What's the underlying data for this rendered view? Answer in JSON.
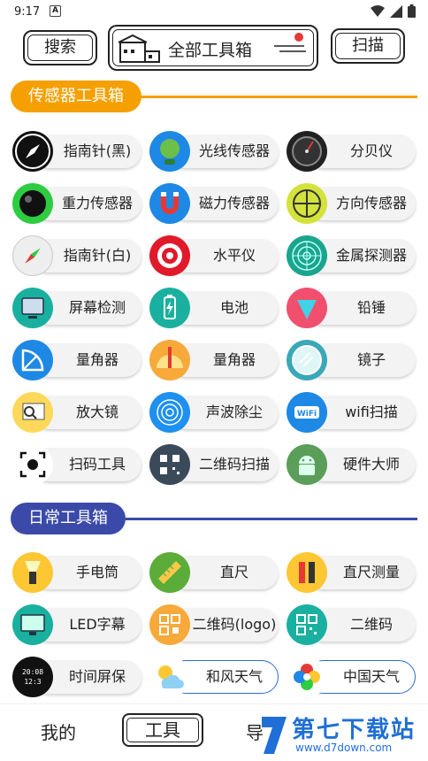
{
  "status": {
    "time": "9:17",
    "notif_letter": "A"
  },
  "header": {
    "search_label": "搜索",
    "title": "全部工具箱",
    "scan_label": "扫描"
  },
  "sections": {
    "sensors": {
      "title": "传感器工具箱",
      "accent": "#f5a000",
      "items": [
        {
          "label": "指南针(黑)",
          "icon": "compass-black-icon"
        },
        {
          "label": "光线传感器",
          "icon": "globe-light-icon"
        },
        {
          "label": "分贝仪",
          "icon": "decibel-meter-icon"
        },
        {
          "label": "重力传感器",
          "icon": "gravity-ball-icon"
        },
        {
          "label": "磁力传感器",
          "icon": "magnet-icon"
        },
        {
          "label": "方向传感器",
          "icon": "level-crosshair-icon"
        },
        {
          "label": "指南针(白)",
          "icon": "compass-white-icon"
        },
        {
          "label": "水平仪",
          "icon": "target-icon"
        },
        {
          "label": "金属探测器",
          "icon": "radar-icon"
        },
        {
          "label": "屏幕检测",
          "icon": "monitor-icon"
        },
        {
          "label": "电池",
          "icon": "battery-icon"
        },
        {
          "label": "铅锤",
          "icon": "plumb-bob-icon"
        },
        {
          "label": "量角器",
          "icon": "protractor-icon"
        },
        {
          "label": "量角器",
          "icon": "protractor-pencil-icon"
        },
        {
          "label": "镜子",
          "icon": "mirror-icon"
        },
        {
          "label": "放大镜",
          "icon": "magnifier-icon"
        },
        {
          "label": "声波除尘",
          "icon": "soundwave-icon"
        },
        {
          "label": "wifi扫描",
          "icon": "wifi-icon"
        },
        {
          "label": "扫码工具",
          "icon": "scan-code-icon"
        },
        {
          "label": "二维码扫描",
          "icon": "qr-scan-icon"
        },
        {
          "label": "硬件大师",
          "icon": "android-icon"
        }
      ]
    },
    "daily": {
      "title": "日常工具箱",
      "accent": "#3b4aa8",
      "items": [
        {
          "label": "手电筒",
          "icon": "flashlight-icon"
        },
        {
          "label": "直尺",
          "icon": "ruler-icon"
        },
        {
          "label": "直尺测量",
          "icon": "ruler-measure-icon"
        },
        {
          "label": "LED字幕",
          "icon": "led-screen-icon"
        },
        {
          "label": "二维码(logo)",
          "icon": "qr-logo-icon"
        },
        {
          "label": "二维码",
          "icon": "qr-code-icon"
        },
        {
          "label": "时间屏保",
          "icon": "clock-screen-icon"
        },
        {
          "label": "和风天气",
          "icon": "weather-icon"
        },
        {
          "label": "中国天气",
          "icon": "china-weather-icon"
        }
      ]
    }
  },
  "nav": {
    "mine": "我的",
    "tools": "工具",
    "third": "导"
  },
  "watermark": {
    "text": "第七下载站",
    "url": "www.d7down.com"
  }
}
